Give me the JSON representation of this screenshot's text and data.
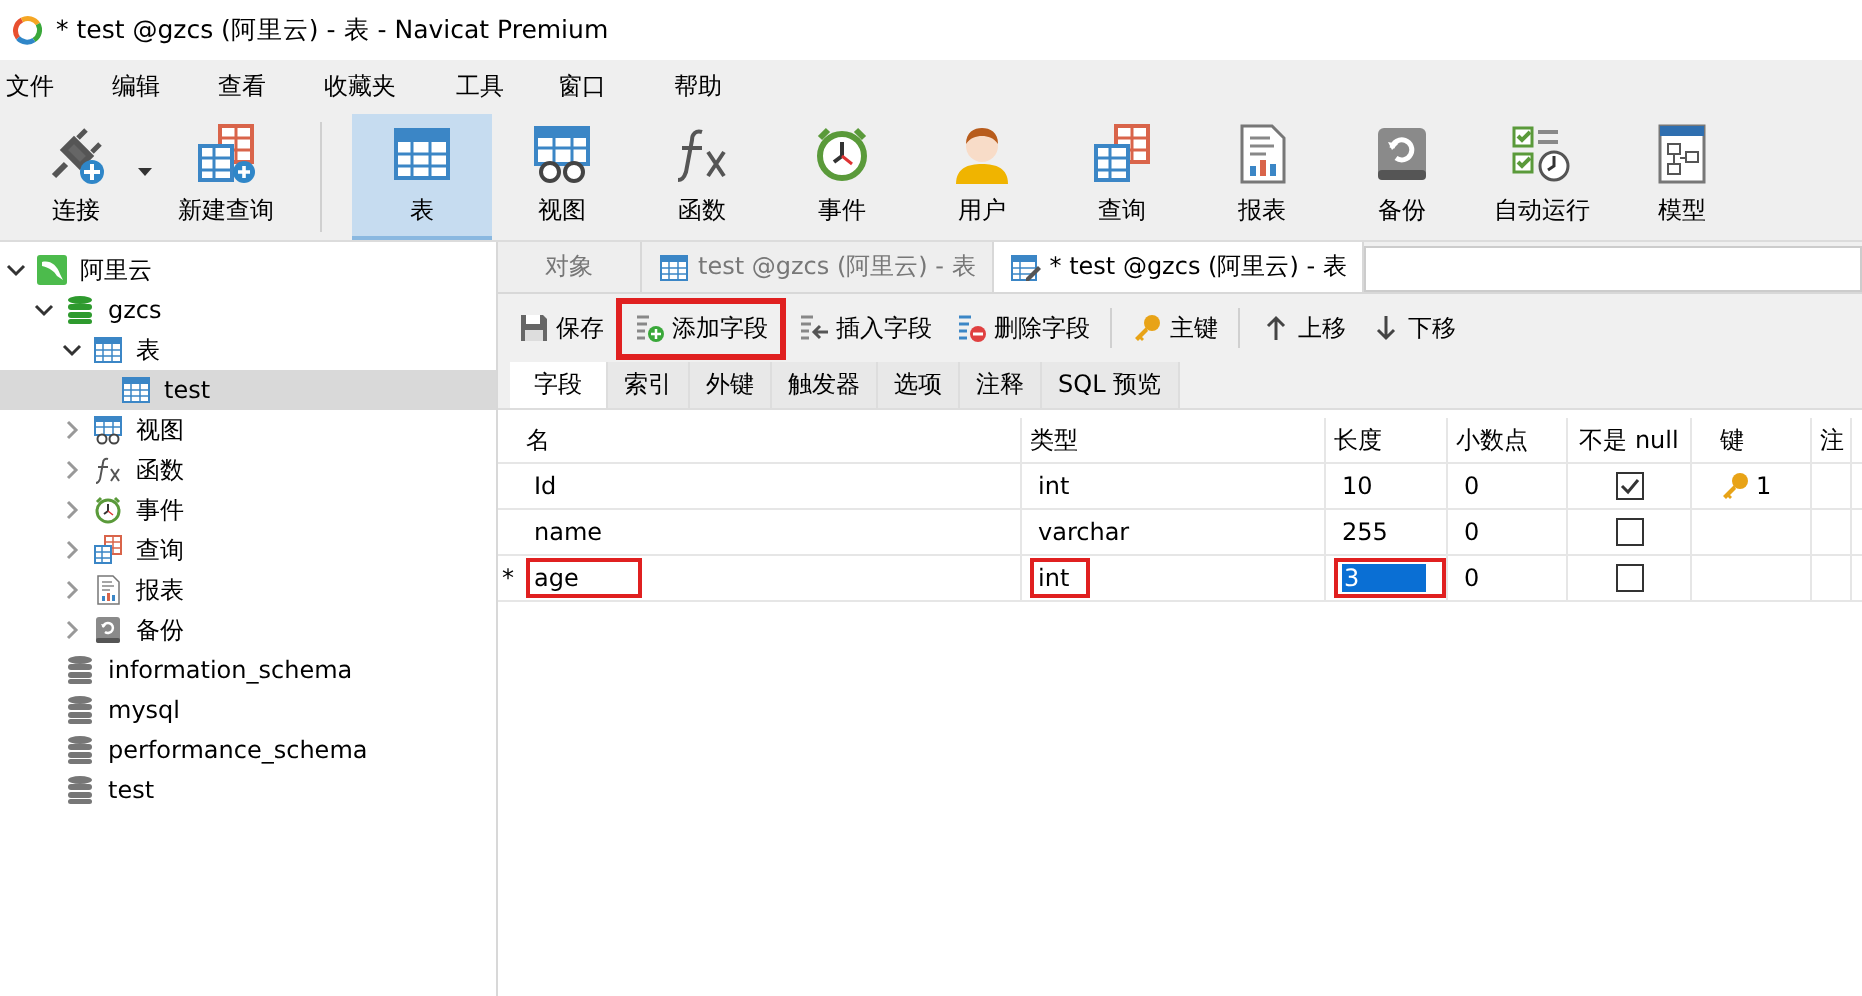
{
  "window": {
    "title": "* test @gzcs (阿里云) - 表 - Navicat Premium"
  },
  "menu": [
    "文件",
    "编辑",
    "查看",
    "收藏夹",
    "工具",
    "窗口",
    "帮助"
  ],
  "toolbar": [
    [
      {
        "label": "连接",
        "kind": "connect",
        "selected": false
      },
      {
        "label": "新建查询",
        "kind": "newquery",
        "selected": false
      }
    ],
    [
      {
        "label": "表",
        "kind": "table",
        "selected": true
      },
      {
        "label": "视图",
        "kind": "view",
        "selected": false
      },
      {
        "label": "函数",
        "kind": "function",
        "selected": false
      },
      {
        "label": "事件",
        "kind": "event",
        "selected": false
      },
      {
        "label": "用户",
        "kind": "user",
        "selected": false
      },
      {
        "label": "查询",
        "kind": "query",
        "selected": false
      },
      {
        "label": "报表",
        "kind": "report",
        "selected": false
      },
      {
        "label": "备份",
        "kind": "backup",
        "selected": false
      },
      {
        "label": "自动运行",
        "kind": "schedule",
        "selected": false
      },
      {
        "label": "模型",
        "kind": "model",
        "selected": false
      }
    ]
  ],
  "tree": [
    {
      "label": "阿里云",
      "kind": "connection",
      "expanded": true,
      "selected": false,
      "children": [
        {
          "label": "gzcs",
          "kind": "db-open",
          "expanded": true,
          "selected": false,
          "children": [
            {
              "label": "表",
              "kind": "table",
              "expanded": true,
              "selected": false,
              "children": [
                {
                  "label": "test",
                  "kind": "table",
                  "selected": true
                }
              ]
            },
            {
              "label": "视图",
              "kind": "view",
              "expanded": false,
              "selected": false
            },
            {
              "label": "函数",
              "kind": "function",
              "expanded": false,
              "selected": false
            },
            {
              "label": "事件",
              "kind": "event",
              "expanded": false,
              "selected": false
            },
            {
              "label": "查询",
              "kind": "query",
              "expanded": false,
              "selected": false
            },
            {
              "label": "报表",
              "kind": "report",
              "expanded": false,
              "selected": false
            },
            {
              "label": "备份",
              "kind": "backup",
              "expanded": false,
              "selected": false
            }
          ]
        },
        {
          "label": "information_schema",
          "kind": "db",
          "selected": false
        },
        {
          "label": "mysql",
          "kind": "db",
          "selected": false
        },
        {
          "label": "performance_schema",
          "kind": "db",
          "selected": false
        },
        {
          "label": "test",
          "kind": "db",
          "selected": false
        }
      ]
    }
  ],
  "tabs": [
    {
      "label": "对象",
      "kind": "plain",
      "selected": false
    },
    {
      "label": "test @gzcs (阿里云) - 表",
      "kind": "table",
      "selected": false
    },
    {
      "label": "* test @gzcs (阿里云) - 表",
      "kind": "design",
      "selected": true
    }
  ],
  "actions": [
    [
      {
        "label": "保存",
        "kind": "save",
        "highlighted": false
      },
      {
        "label": "添加字段",
        "kind": "add",
        "highlighted": true
      },
      {
        "label": "插入字段",
        "kind": "insert",
        "highlighted": false
      },
      {
        "label": "删除字段",
        "kind": "delete",
        "highlighted": false
      }
    ],
    [
      {
        "label": "主键",
        "kind": "key",
        "highlighted": false
      }
    ],
    [
      {
        "label": "上移",
        "kind": "up",
        "highlighted": false
      },
      {
        "label": "下移",
        "kind": "down",
        "highlighted": false
      }
    ]
  ],
  "subtabs": [
    {
      "label": "字段",
      "selected": true
    },
    {
      "label": "索引",
      "selected": false
    },
    {
      "label": "外键",
      "selected": false
    },
    {
      "label": "触发器",
      "selected": false
    },
    {
      "label": "选项",
      "selected": false
    },
    {
      "label": "注释",
      "selected": false
    },
    {
      "label": "SQL 预览",
      "selected": false
    }
  ],
  "table": {
    "columns": [
      "名",
      "类型",
      "长度",
      "小数点",
      "不是 null",
      "键",
      "注"
    ],
    "rows": [
      {
        "cells": [
          {
            "text": "Id",
            "highlighted": false
          },
          {
            "text": "int",
            "highlighted": false
          },
          {
            "text": "10",
            "highlighted": false
          },
          {
            "text": "0",
            "highlighted": false
          }
        ],
        "not_null": true,
        "key": "1",
        "editing": false
      },
      {
        "cells": [
          {
            "text": "name",
            "highlighted": false
          },
          {
            "text": "varchar",
            "highlighted": false
          },
          {
            "text": "255",
            "highlighted": false
          },
          {
            "text": "0",
            "highlighted": false
          }
        ],
        "not_null": false,
        "key": "",
        "editing": false
      },
      {
        "marker": "*",
        "cells": [
          {
            "text": "age",
            "highlighted": true
          },
          {
            "text": "int",
            "highlighted": true
          },
          {
            "text": "3",
            "highlighted": true
          },
          {
            "text": "0",
            "highlighted": false
          }
        ],
        "not_null": false,
        "key": "",
        "editing": true
      }
    ]
  }
}
